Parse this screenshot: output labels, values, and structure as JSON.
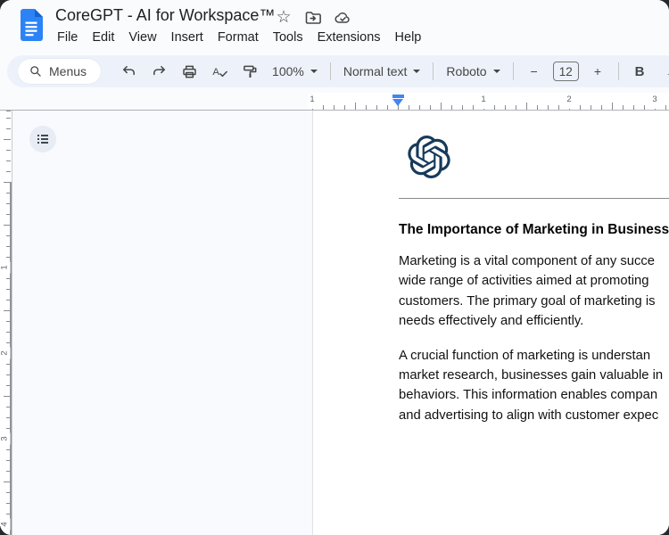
{
  "header": {
    "doc_icon": "google-docs-icon",
    "title": "CoreGPT - AI for Workspace™",
    "action_icons": [
      "star-icon",
      "move-to-folder-icon",
      "cloud-saved-icon"
    ],
    "menu_items": [
      "File",
      "Edit",
      "View",
      "Insert",
      "Format",
      "Tools",
      "Extensions",
      "Help"
    ]
  },
  "toolbar": {
    "menus_label": "Menus",
    "icon_buttons": [
      "search-icon",
      "undo-icon",
      "redo-icon",
      "print-icon",
      "spellcheck-icon",
      "paint-format-icon"
    ],
    "zoom_value": "100%",
    "style_value": "Normal text",
    "font_value": "Roboto",
    "minus_label": "−",
    "font_size_value": "12",
    "plus_label": "+",
    "bold_label": "B",
    "italic_label": "I"
  },
  "ruler": {
    "horizontal_labels": [
      "1",
      "1",
      "2",
      "3"
    ],
    "vertical_labels": [
      "1",
      "2",
      "3",
      "4"
    ],
    "indent_marker_color": "#4285f4"
  },
  "sidebar": {
    "outline_button_icon": "document-outline-icon"
  },
  "document": {
    "logo": "openai-logo",
    "logo_color": "#173A5A",
    "heading": "The Importance of Marketing in Business",
    "paragraphs": [
      {
        "lines": [
          "Marketing is a vital component of any succe",
          "wide range of activities aimed at promoting",
          "customers. The primary goal of marketing is",
          "needs effectively and efficiently."
        ]
      },
      {
        "lines": [
          "A crucial function of marketing is understan",
          "market research, businesses gain valuable in",
          "behaviors. This information enables compan",
          "and advertising to align with customer expec"
        ]
      }
    ]
  },
  "colors": {
    "chrome_bg": "#f9fbfd",
    "toolbar_bg": "#edf2fa",
    "canvas_bg": "#f8fafd",
    "page_bg": "#ffffff",
    "accent_blue": "#1a73e8",
    "docs_icon_blue": "#2b83f6",
    "icon_gray": "#444746"
  }
}
